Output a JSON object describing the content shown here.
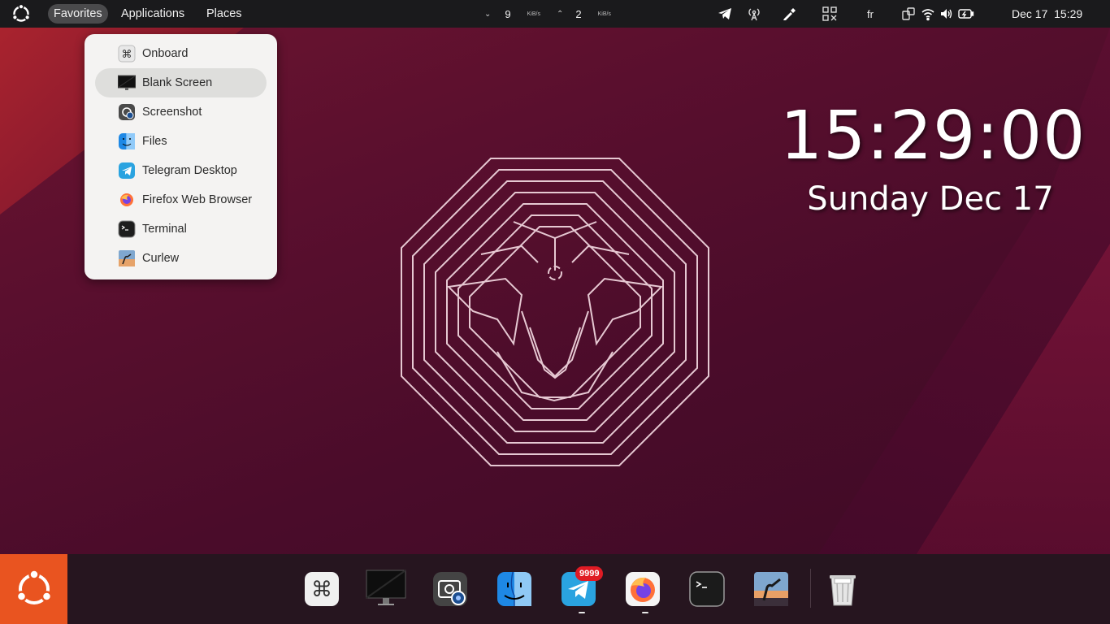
{
  "topbar": {
    "menus": [
      "Favorites",
      "Applications",
      "Places"
    ],
    "net_down": "9",
    "net_down_unit": "KiB/s",
    "net_up": "2",
    "net_up_unit": "KiB/s",
    "keyboard_layout": "fr",
    "date": "Dec 17",
    "time": "15:29"
  },
  "favorites_menu": {
    "items": [
      {
        "label": "Onboard",
        "icon": "onboard-icon"
      },
      {
        "label": "Blank Screen",
        "icon": "monitor-icon"
      },
      {
        "label": "Screenshot",
        "icon": "camera-icon"
      },
      {
        "label": "Files",
        "icon": "files-icon"
      },
      {
        "label": "Telegram Desktop",
        "icon": "telegram-icon"
      },
      {
        "label": "Firefox Web Browser",
        "icon": "firefox-icon"
      },
      {
        "label": "Terminal",
        "icon": "terminal-icon"
      },
      {
        "label": "Curlew",
        "icon": "curlew-icon"
      }
    ],
    "hovered_index": 1
  },
  "desktop_clock": {
    "time": "15:29:00",
    "date": "Sunday Dec 17"
  },
  "dock": {
    "telegram_badge": "9999",
    "accent": "#e95420"
  }
}
